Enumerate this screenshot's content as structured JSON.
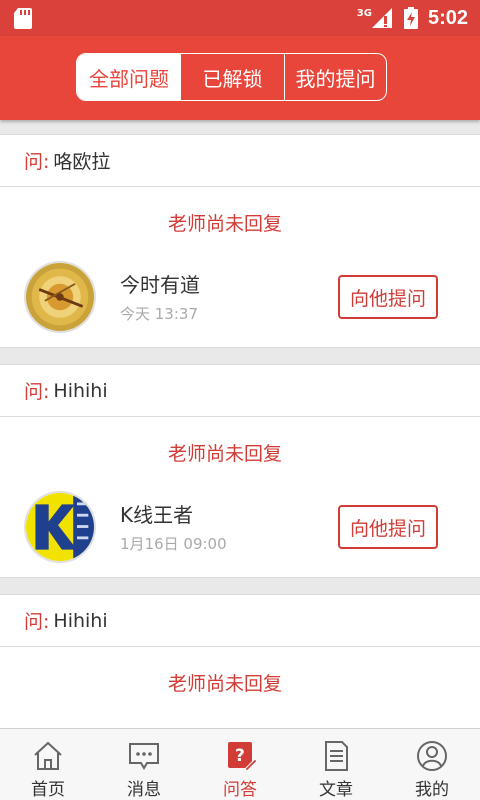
{
  "status_bar": {
    "network": "3G",
    "time": "5:02"
  },
  "tabs": [
    {
      "label": "全部问题",
      "selected": true
    },
    {
      "label": "已解锁",
      "selected": false
    },
    {
      "label": "我的提问",
      "selected": false
    }
  ],
  "questions": [
    {
      "prefix": "问:",
      "text": "咯欧拉",
      "status": "老师尚未回复",
      "expert_name": "今时有道",
      "time": "今天 13:37",
      "button": "向他提问",
      "avatar_icon": "compass-avatar-icon"
    },
    {
      "prefix": "问:",
      "text": "Hihihi",
      "status": "老师尚未回复",
      "expert_name": "K线王者",
      "time": "1月16日 09:00",
      "button": "向他提问",
      "avatar_icon": "k-logo-avatar-icon"
    },
    {
      "prefix": "问:",
      "text": "Hihihi",
      "status": "老师尚未回复"
    }
  ],
  "bottom_nav": [
    {
      "label": "首页",
      "icon": "home-icon",
      "active": false
    },
    {
      "label": "消息",
      "icon": "message-icon",
      "active": false
    },
    {
      "label": "问答",
      "icon": "qa-icon",
      "active": true
    },
    {
      "label": "文章",
      "icon": "article-icon",
      "active": false
    },
    {
      "label": "我的",
      "icon": "profile-icon",
      "active": false
    }
  ],
  "colors": {
    "status_bar": "#d9413a",
    "header": "#e8453b",
    "accent": "#d23c36"
  }
}
